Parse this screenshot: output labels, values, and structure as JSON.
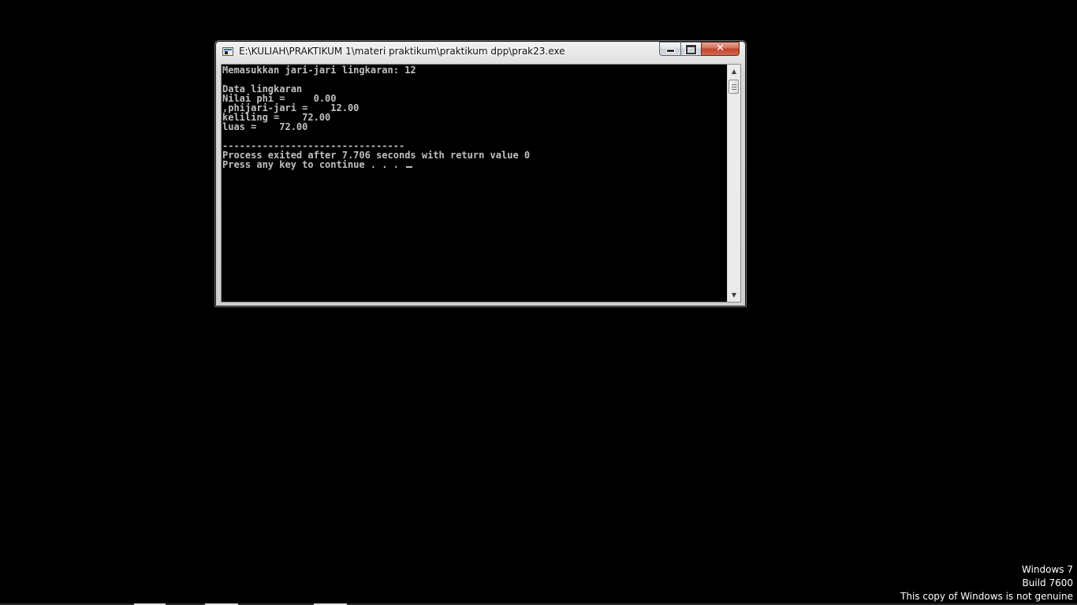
{
  "window": {
    "title": "E:\\KULIAH\\PRAKTIKUM 1\\materi praktikum\\praktikum dpp\\prak23.exe",
    "controls": {
      "minimize_icon": "minimize-icon",
      "maximize_icon": "maximize-icon",
      "close_icon": "close-icon",
      "close_glyph": "✕"
    }
  },
  "console": {
    "lines": [
      "Memasukkan jari-jari lingkaran: 12",
      "",
      "Data lingkaran",
      "Nilai phi =     0.00",
      ",phijari-jari =    12.00",
      "keliling =    72.00",
      "luas =    72.00",
      "",
      "--------------------------------",
      "Process exited after 7.706 seconds with return value 0",
      "Press any key to continue . . . "
    ]
  },
  "scrollbar": {
    "up_glyph": "▲",
    "down_glyph": "▼"
  },
  "watermark": {
    "line1": "Windows 7",
    "line2": "Build 7600",
    "line3": "This copy of Windows is not genuine"
  }
}
